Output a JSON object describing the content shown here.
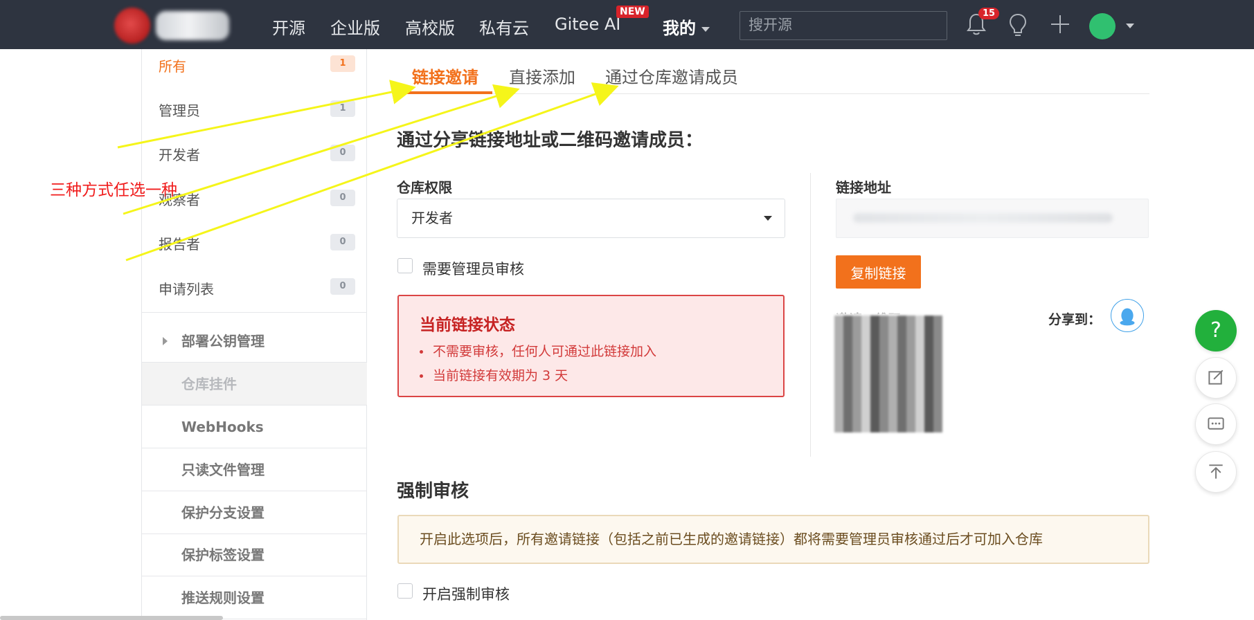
{
  "nav": {
    "links": [
      "开源",
      "企业版",
      "高校版",
      "私有云",
      "Gitee AI"
    ],
    "new_badge": "NEW",
    "mine": "我的",
    "search_placeholder": "搜开源",
    "notification_count": "15"
  },
  "sidebar": {
    "roles": [
      {
        "label": "所有",
        "count": "1"
      },
      {
        "label": "管理员",
        "count": "1"
      },
      {
        "label": "开发者",
        "count": "0"
      },
      {
        "label": "观察者",
        "count": "0"
      },
      {
        "label": "报告者",
        "count": "0"
      },
      {
        "label": "申请列表",
        "count": "0"
      }
    ],
    "links": [
      "部署公钥管理",
      "仓库挂件",
      "WebHooks",
      "只读文件管理",
      "保护分支设置",
      "保护标签设置",
      "推送规则设置"
    ]
  },
  "tabs": [
    "链接邀请",
    "直接添加",
    "通过仓库邀请成员"
  ],
  "main": {
    "heading": "通过分享链接地址或二维码邀请成员：",
    "permission_label": "仓库权限",
    "permission_value": "开发者",
    "review_checkbox": "需要管理员审核",
    "status_title": "当前链接状态",
    "status_items": [
      "不需要审核，任何人可通过此链接加入",
      "当前链接有效期为 3 天"
    ],
    "link_label": "链接地址",
    "copy_button": "复制链接",
    "qr_label": "邀请二维码",
    "share_label": "分享到：",
    "force_title": "强制审核",
    "force_notice": "开启此选项后，所有邀请链接（包括之前已生成的邀请链接）都将需要管理员审核通过后才可加入仓库",
    "force_checkbox": "开启强制审核"
  },
  "annotation": "三种方式任选一种",
  "colors": {
    "accent": "#f2711c",
    "nav_bg": "#2e3440",
    "annotation": "#f01b1b",
    "arrow": "#f5f51a"
  },
  "float_buttons": {
    "help": "?"
  }
}
